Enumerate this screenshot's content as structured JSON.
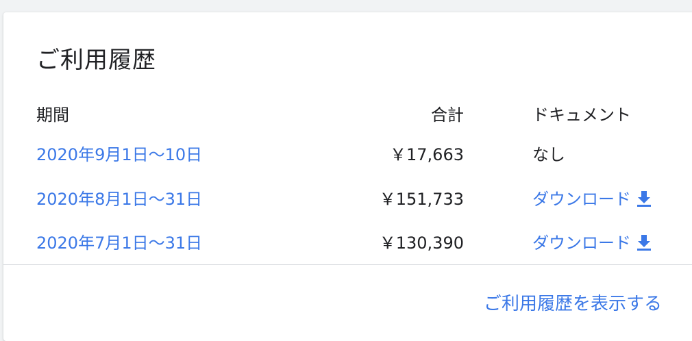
{
  "usage_history": {
    "title": "ご利用履歴",
    "columns": {
      "period": "期間",
      "total": "合計",
      "document": "ドキュメント"
    },
    "rows": [
      {
        "period": "2020年9月1日～10日",
        "total": "￥17,663",
        "document": "なし",
        "document_is_download": false
      },
      {
        "period": "2020年8月1日～31日",
        "total": "￥151,733",
        "document": "ダウンロード",
        "document_is_download": true
      },
      {
        "period": "2020年7月1日～31日",
        "total": "￥130,390",
        "document": "ダウンロード",
        "document_is_download": true
      }
    ],
    "footer_link": "ご利用履歴を表示する"
  },
  "icons": {
    "download": "download-icon"
  },
  "colors": {
    "link": "#3b78e7",
    "text": "#202124",
    "divider": "#dadce0"
  }
}
